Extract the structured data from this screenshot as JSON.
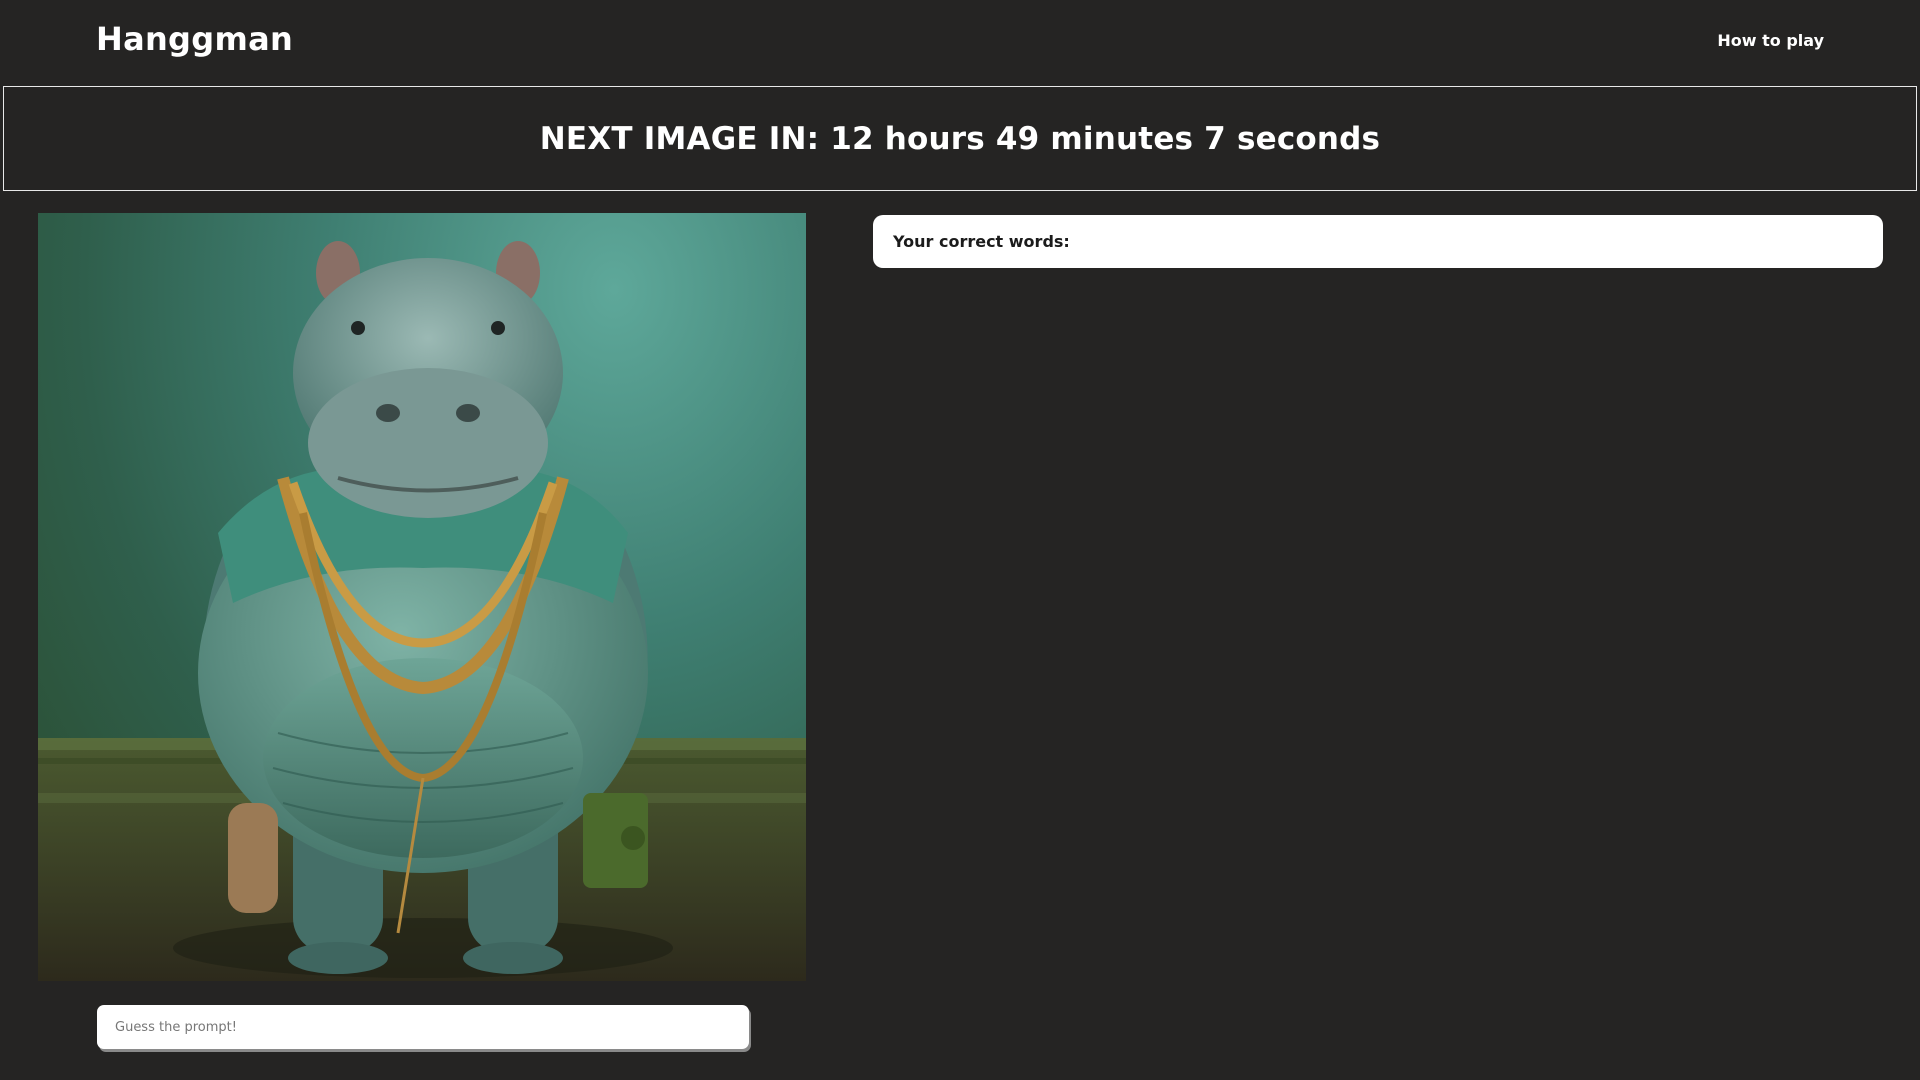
{
  "header": {
    "title": "Hanggman",
    "how_to_play": "How to play"
  },
  "banner": {
    "text": "NEXT IMAGE IN: 12 hours 49 minutes 7 seconds"
  },
  "guess": {
    "placeholder": "Guess the prompt!",
    "value": ""
  },
  "words_panel": {
    "label": "Your correct words:",
    "words": []
  },
  "colors": {
    "background": "#252423",
    "panel": "#ffffff",
    "text": "#ffffff"
  }
}
